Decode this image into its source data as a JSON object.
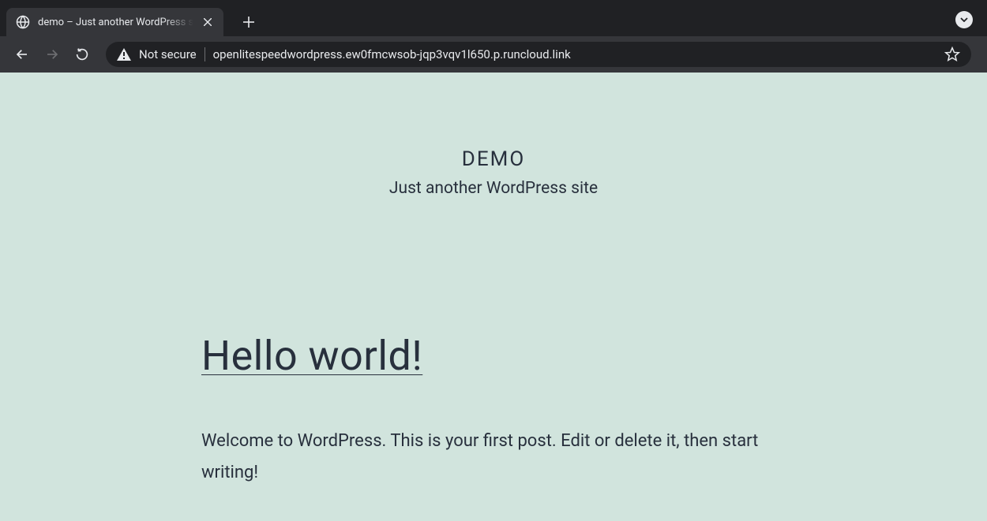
{
  "browser": {
    "tab_title": "demo – Just another WordPress s",
    "security_label": "Not secure",
    "url": "openlitespeedwordpress.ew0fmcwsob-jqp3vqv1l650.p.runcloud.link"
  },
  "site": {
    "title": "DEMO",
    "tagline": "Just another WordPress site"
  },
  "post": {
    "title": "Hello world!",
    "body": "Welcome to WordPress. This is your first post. Edit or delete it, then start writing!"
  }
}
